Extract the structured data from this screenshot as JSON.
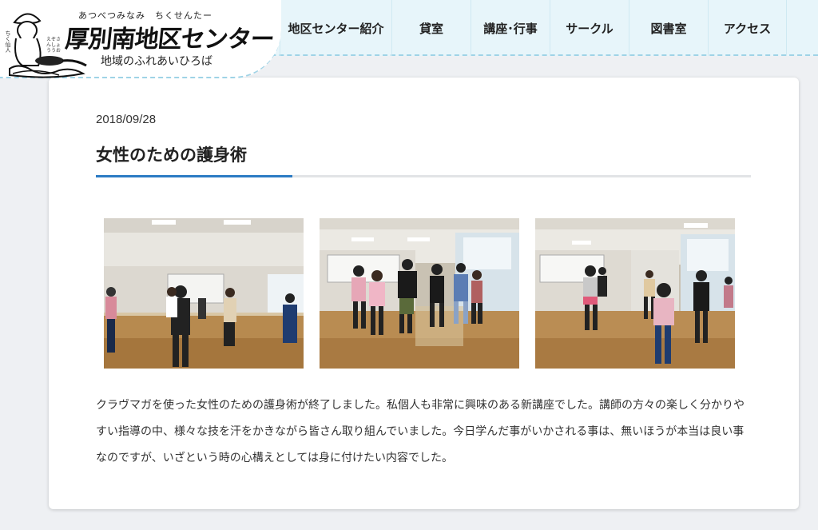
{
  "site": {
    "logo_ruby": "あつべつみなみ　ちくせんたー",
    "logo_title": "厚別南地区センター",
    "logo_subtitle": "地域のふれあいひろば",
    "logo_side_text": "ちく仙人",
    "logo_side_text2": "えぞさんしょううお"
  },
  "nav": {
    "items": [
      {
        "label": "地区センター紹介"
      },
      {
        "label": "貸室"
      },
      {
        "label": "講座･行事"
      },
      {
        "label": "サークル"
      },
      {
        "label": "図書室"
      },
      {
        "label": "アクセス"
      }
    ]
  },
  "post": {
    "date": "2018/09/28",
    "title": "女性のための護身術",
    "photos": [
      {
        "name": "photo-1"
      },
      {
        "name": "photo-2"
      },
      {
        "name": "photo-3"
      }
    ],
    "body": "クラヴマガを使った女性のための護身術が終了しました。私個人も非常に興味のある新講座でした。講師の方々の楽しく分かりやすい指導の中、様々な技を汗をかきながら皆さん取り組んでいました。今日学んだ事がいかされる事は、無いほうが本当は良い事なのですが、いざという時の心構えとしては身に付けたい内容でした。"
  },
  "colors": {
    "header_bg": "#e7f5fa",
    "accent": "#2c7bc4",
    "page_bg": "#eef0f3"
  }
}
